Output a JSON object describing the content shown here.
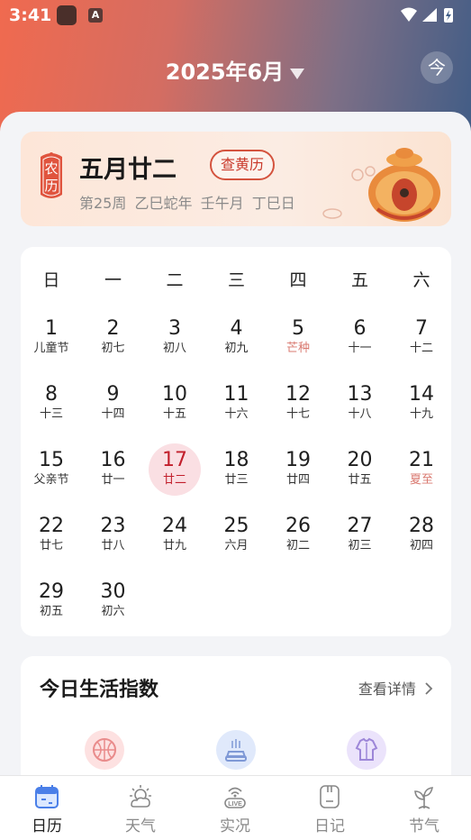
{
  "status_bar": {
    "time": "3:41",
    "app_badge": "A"
  },
  "header": {
    "month_title": "2025年6月",
    "today_button": "今"
  },
  "lunar_card": {
    "tag_text": "农历",
    "lunar_date": "五月廿二",
    "huangli_button": "查黄历",
    "week": "第25周",
    "year_ganzhi": "乙巳蛇年",
    "month_ganzhi": "壬午月",
    "day_ganzhi": "丁巳日"
  },
  "calendar": {
    "weekdays": [
      "日",
      "一",
      "二",
      "三",
      "四",
      "五",
      "六"
    ],
    "selected_day": "17",
    "days": [
      {
        "day": "1",
        "sub": "儿童节",
        "term": false
      },
      {
        "day": "2",
        "sub": "初七",
        "term": false
      },
      {
        "day": "3",
        "sub": "初八",
        "term": false
      },
      {
        "day": "4",
        "sub": "初九",
        "term": false
      },
      {
        "day": "5",
        "sub": "芒种",
        "term": true
      },
      {
        "day": "6",
        "sub": "十一",
        "term": false
      },
      {
        "day": "7",
        "sub": "十二",
        "term": false
      },
      {
        "day": "8",
        "sub": "十三",
        "term": false
      },
      {
        "day": "9",
        "sub": "十四",
        "term": false
      },
      {
        "day": "10",
        "sub": "十五",
        "term": false
      },
      {
        "day": "11",
        "sub": "十六",
        "term": false
      },
      {
        "day": "12",
        "sub": "十七",
        "term": false
      },
      {
        "day": "13",
        "sub": "十八",
        "term": false
      },
      {
        "day": "14",
        "sub": "十九",
        "term": false
      },
      {
        "day": "15",
        "sub": "父亲节",
        "term": false
      },
      {
        "day": "16",
        "sub": "廿一",
        "term": false
      },
      {
        "day": "17",
        "sub": "廿二",
        "term": false
      },
      {
        "day": "18",
        "sub": "廿三",
        "term": false
      },
      {
        "day": "19",
        "sub": "廿四",
        "term": false
      },
      {
        "day": "20",
        "sub": "廿五",
        "term": false
      },
      {
        "day": "21",
        "sub": "夏至",
        "term": true
      },
      {
        "day": "22",
        "sub": "廿七",
        "term": false
      },
      {
        "day": "23",
        "sub": "廿八",
        "term": false
      },
      {
        "day": "24",
        "sub": "廿九",
        "term": false
      },
      {
        "day": "25",
        "sub": "六月",
        "term": false
      },
      {
        "day": "26",
        "sub": "初二",
        "term": false
      },
      {
        "day": "27",
        "sub": "初三",
        "term": false
      },
      {
        "day": "28",
        "sub": "初四",
        "term": false
      },
      {
        "day": "29",
        "sub": "初五",
        "term": false
      },
      {
        "day": "30",
        "sub": "初六",
        "term": false
      }
    ]
  },
  "life_index": {
    "title": "今日生活指数",
    "more_label": "查看详情",
    "icons": [
      "basketball-icon",
      "car-wash-icon",
      "clothing-icon"
    ]
  },
  "tabbar": {
    "items": [
      {
        "label": "日历",
        "icon": "calendar-icon",
        "active": true
      },
      {
        "label": "天气",
        "icon": "weather-icon",
        "active": false
      },
      {
        "label": "实况",
        "icon": "live-icon",
        "active": false
      },
      {
        "label": "日记",
        "icon": "diary-icon",
        "active": false
      },
      {
        "label": "节气",
        "icon": "solar-term-icon",
        "active": false
      }
    ]
  },
  "colors": {
    "accent_red": "#c21f2c",
    "solar_term": "#d9786f",
    "selected_bg": "#fadfe3"
  }
}
